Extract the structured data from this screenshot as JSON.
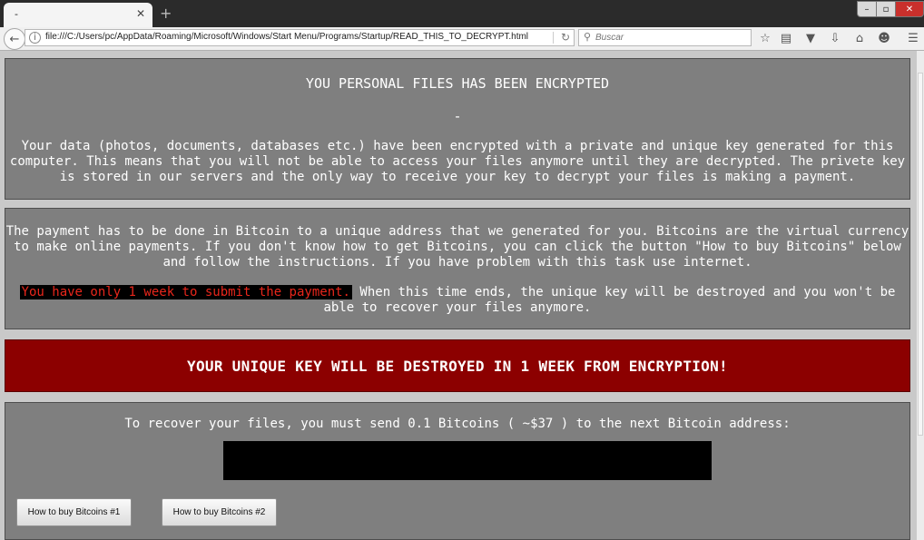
{
  "browser": {
    "tab_title": "-",
    "tab_close": "✕",
    "new_tab": "+",
    "url": "file:///C:/Users/pc/AppData/Roaming/Microsoft/Windows/Start Menu/Programs/Startup/READ_THIS_TO_DECRYPT.html",
    "search_placeholder": "Buscar",
    "icons": [
      "back-arrow-icon",
      "info-icon",
      "reload-icon",
      "search-icon",
      "star-icon",
      "reading-list-icon",
      "pocket-icon",
      "download-icon",
      "home-icon",
      "chat-icon",
      "menu-icon"
    ]
  },
  "window_controls": {
    "minimize": "–",
    "maximize": "▫",
    "close": "✕"
  },
  "content": {
    "box1": {
      "heading": "YOU PERSONAL FILES HAS BEEN ENCRYPTED",
      "separator": "-",
      "paragraph": "Your data (photos, documents, databases etc.) have been encrypted with a private and unique key generated for this computer. This means that you will not be able to access your files anymore until they are decrypted. The privete key is stored in our servers and the only way to receive your key to decrypt your files is making a payment."
    },
    "box2": {
      "paragraph1": "The payment has to be done in Bitcoin to a unique address that we generated for you. Bitcoins are the virtual currency to make online payments. If you don't know how to get Bitcoins, you can click the button \"How to buy Bitcoins\" below and follow the instructions. If you have problem with this task use internet.",
      "warning": "You have only 1 week to submit the payment.",
      "paragraph2": " When this time ends, the unique key will be destroyed and you won't be able to recover your files anymore."
    },
    "alert_banner": "YOUR UNIQUE KEY WILL BE DESTROYED IN 1 WEEK FROM ENCRYPTION!",
    "box4": {
      "instruction": "To recover your files, you must send 0.1 Bitcoins ( ~$37 ) to the next Bitcoin address:",
      "button1": "How to buy Bitcoins #1",
      "button2": "How to buy Bitcoins #2"
    }
  },
  "colors": {
    "panel_gray": "#7f7f7f",
    "alert_red": "#8c0000",
    "warning_text_red": "#e8261b",
    "page_bg": "#c9c9c9"
  }
}
